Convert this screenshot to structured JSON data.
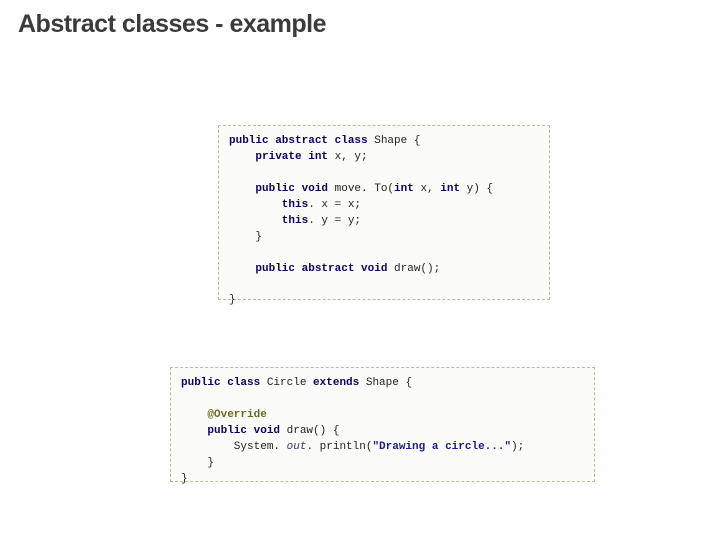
{
  "title": "Abstract classes - example",
  "code1": {
    "l1a": "public abstract class ",
    "l1b": "Shape {",
    "l2a": "    private int ",
    "l2b": "x, y;",
    "l3": "",
    "l4a": "    public void ",
    "l4b": "move. To(",
    "l4c": "int ",
    "l4d": "x, ",
    "l4e": "int ",
    "l4f": "y) {",
    "l5a": "        this",
    "l5b": ". x = x;",
    "l6a": "        this",
    "l6b": ". y = y;",
    "l7": "    }",
    "l8": "",
    "l9a": "    public abstract void ",
    "l9b": "draw();",
    "l10": "",
    "l11": "}"
  },
  "code2": {
    "l1a": "public class ",
    "l1b": "Circle ",
    "l1c": "extends ",
    "l1d": "Shape {",
    "l2": "",
    "l3": "    @Override",
    "l4a": "    public void ",
    "l4b": "draw() {",
    "l5a": "        System.",
    "l5b": " out",
    "l5c": ". println(",
    "l5d": "\"Drawing a circle...\"",
    "l5e": ");",
    "l6": "    }",
    "l7": "}"
  }
}
